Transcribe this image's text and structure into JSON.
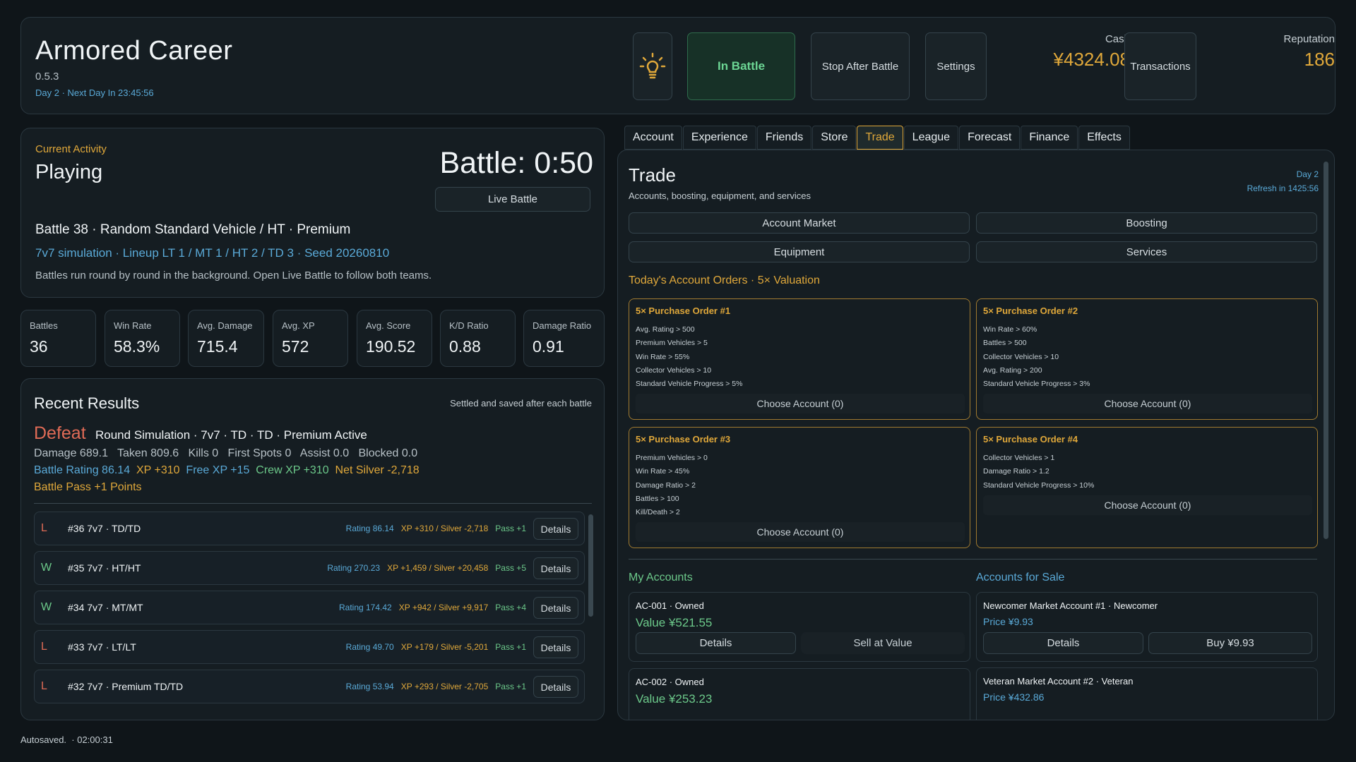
{
  "header": {
    "title": "Armored Career",
    "version": "0.5.3",
    "day_line": "Day 2 · Next Day In 23:45:56",
    "in_battle_label": "In Battle",
    "stop_after_label": "Stop After Battle",
    "settings_label": "Settings",
    "cash_label": "Cash",
    "cash_value": "¥4324.08",
    "transactions_label": "Transactions",
    "reputation_label": "Reputation",
    "reputation_value": "186",
    "lamp_icon": "lightbulb-icon"
  },
  "activity": {
    "label": "Current Activity",
    "status": "Playing",
    "timer": "Battle: 0:50",
    "live_battle_label": "Live Battle",
    "battle_desc": "Battle 38 · Random Standard Vehicle / HT · Premium",
    "simulation": "7v7 simulation · Lineup LT 1 / MT 1 / HT 2 / TD 3 · Seed 20260810",
    "note": "Battles run round by round in the background. Open Live Battle to follow both teams."
  },
  "stats": [
    {
      "label": "Battles",
      "value": "36"
    },
    {
      "label": "Win Rate",
      "value": "58.3%"
    },
    {
      "label": "Avg. Damage",
      "value": "715.4"
    },
    {
      "label": "Avg. XP",
      "value": "572"
    },
    {
      "label": "Avg. Score",
      "value": "190.52"
    },
    {
      "label": "K/D Ratio",
      "value": "0.88"
    },
    {
      "label": "Damage Ratio",
      "value": "0.91"
    }
  ],
  "recent": {
    "title": "Recent Results",
    "note": "Settled and saved after each battle",
    "result": "Defeat",
    "mode": "Round Simulation · 7v7 · TD · TD · Premium Active",
    "line1": "Damage 689.1   Taken 809.6   Kills 0   First Spots 0   Assist 0.0   Blocked 0.0",
    "rating": "Battle Rating 86.14",
    "xp": "XP +310",
    "free_xp": "Free XP +15",
    "crew_xp": "Crew XP +310",
    "net_silver": "Net Silver -2,718",
    "pass": "Battle Pass +1 Points",
    "rows": [
      {
        "res": "L",
        "name": "#36  7v7 · TD/TD",
        "rating": "Rating 86.14",
        "xp": "XP +310 / Silver -2,718",
        "pass": "Pass +1",
        "details": "Details"
      },
      {
        "res": "W",
        "name": "#35  7v7 · HT/HT",
        "rating": "Rating 270.23",
        "xp": "XP +1,459 / Silver +20,458",
        "pass": "Pass +5",
        "details": "Details"
      },
      {
        "res": "W",
        "name": "#34  7v7 · MT/MT",
        "rating": "Rating 174.42",
        "xp": "XP +942 / Silver +9,917",
        "pass": "Pass +4",
        "details": "Details"
      },
      {
        "res": "L",
        "name": "#33  7v7 · LT/LT",
        "rating": "Rating 49.70",
        "xp": "XP +179 / Silver -5,201",
        "pass": "Pass +1",
        "details": "Details"
      },
      {
        "res": "L",
        "name": "#32  7v7 · Premium TD/TD",
        "rating": "Rating 53.94",
        "xp": "XP +293 / Silver -2,705",
        "pass": "Pass +1",
        "details": "Details"
      }
    ]
  },
  "autosave": "Autosaved.  · 02:00:31",
  "tabs": [
    "Account",
    "Experience",
    "Friends",
    "Store",
    "Trade",
    "League",
    "Forecast",
    "Finance",
    "Effects"
  ],
  "active_tab": "Trade",
  "trade": {
    "title": "Trade",
    "subtitle": "Accounts, boosting, equipment, and services",
    "day": "Day 2",
    "refresh": "Refresh in 1425:56",
    "categories": [
      "Account Market",
      "Boosting",
      "Equipment",
      "Services"
    ],
    "orders_title": "Today's Account Orders · 5× Valuation",
    "orders": [
      {
        "title": "5× Purchase Order #1",
        "reqs": [
          "Avg. Rating > 500",
          "Premium Vehicles > 5",
          "Win Rate > 55%",
          "Collector Vehicles > 10",
          "Standard Vehicle Progress > 5%"
        ],
        "choose": "Choose Account (0)"
      },
      {
        "title": "5× Purchase Order #2",
        "reqs": [
          "Win Rate > 60%",
          "Battles > 500",
          "Collector Vehicles > 10",
          "Avg. Rating > 200",
          "Standard Vehicle Progress > 3%"
        ],
        "choose": "Choose Account (0)"
      },
      {
        "title": "5× Purchase Order #3",
        "reqs": [
          "Premium Vehicles > 0",
          "Win Rate > 45%",
          "Damage Ratio > 2",
          "Battles > 100",
          "Kill/Death > 2"
        ],
        "choose": "Choose Account (0)"
      },
      {
        "title": "5× Purchase Order #4",
        "reqs": [
          "Collector Vehicles > 1",
          "Damage Ratio > 1.2",
          "Standard Vehicle Progress > 10%"
        ],
        "choose": "Choose Account (0)"
      }
    ],
    "my_accounts_title": "My Accounts",
    "for_sale_title": "Accounts for Sale",
    "my_accounts": [
      {
        "name": "AC-001 · Owned",
        "value": "Value ¥521.55",
        "details": "Details",
        "sell": "Sell at Value"
      },
      {
        "name": "AC-002 · Owned",
        "value": "Value ¥253.23",
        "details": "",
        "sell": ""
      }
    ],
    "for_sale": [
      {
        "name": "Newcomer Market Account #1 · Newcomer",
        "price": "Price ¥9.93",
        "details": "Details",
        "buy": "Buy ¥9.93"
      },
      {
        "name": "Veteran Market Account #2 · Veteran",
        "price": "Price ¥432.86",
        "details": "",
        "buy": ""
      }
    ]
  }
}
